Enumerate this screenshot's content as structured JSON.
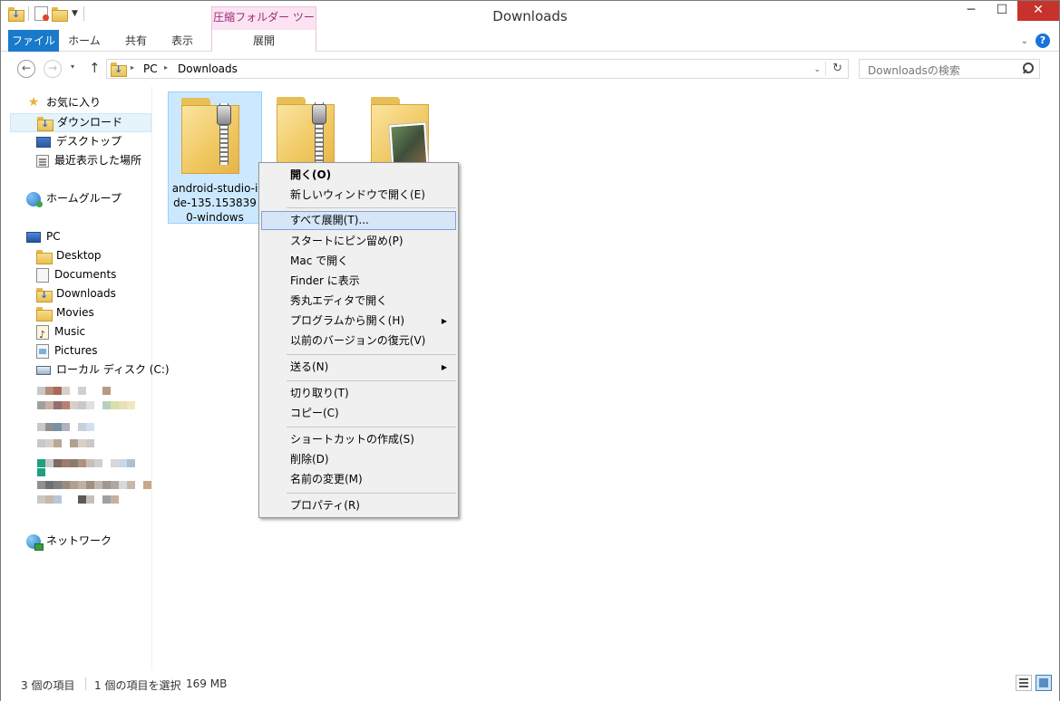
{
  "window": {
    "title": "Downloads"
  },
  "ribbon": {
    "context_group_label": "圧縮フォルダー ツール",
    "tabs": {
      "file": "ファイル",
      "home": "ホーム",
      "share": "共有",
      "view": "表示",
      "extract": "展開"
    },
    "help_label": "?"
  },
  "caption": {
    "minimize": "─",
    "maximize": "☐",
    "close": "✕"
  },
  "address": {
    "back": "←",
    "forward": "→",
    "dropdown": "▾",
    "up": "↑",
    "crumbs": [
      "PC",
      "Downloads"
    ],
    "refresh": "↻",
    "separator": "▸"
  },
  "search": {
    "placeholder": "Downloadsの検索"
  },
  "nav": {
    "favorites": "お気に入り",
    "downloads_jp": "ダウンロード",
    "desktop_jp": "デスクトップ",
    "recent": "最近表示した場所",
    "homegroup": "ホームグループ",
    "pc": "PC",
    "desktop": "Desktop",
    "documents": "Documents",
    "downloads": "Downloads",
    "movies": "Movies",
    "music": "Music",
    "pictures": "Pictures",
    "local_disk": "ローカル ディスク (C:)",
    "network": "ネットワーク"
  },
  "items": [
    {
      "name": "android-studio-ide-135.1538390-windows",
      "selected": true,
      "icon": "zip-folder-icon"
    },
    {
      "name": "",
      "selected": false,
      "icon": "zip-folder-icon"
    },
    {
      "name": "",
      "selected": false,
      "icon": "photo-folder-icon"
    }
  ],
  "context_menu": {
    "open": "開く(O)",
    "open_new_window": "新しいウィンドウで開く(E)",
    "extract_all": "すべて展開(T)...",
    "pin_start": "スタートにピン留め(P)",
    "open_mac": "Mac で開く",
    "show_finder": "Finder に表示",
    "open_hidemaru": "秀丸エディタで開く",
    "open_with": "プログラムから開く(H)",
    "restore_versions": "以前のバージョンの復元(V)",
    "send_to": "送る(N)",
    "cut": "切り取り(T)",
    "copy": "コピー(C)",
    "create_shortcut": "ショートカットの作成(S)",
    "delete": "削除(D)",
    "rename": "名前の変更(M)",
    "properties": "プロパティ(R)"
  },
  "status": {
    "item_count": "3 個の項目",
    "selection": "1 個の項目を選択",
    "size": "169 MB"
  },
  "colors": {
    "accent": "#1979ca",
    "selection": "#cce8ff",
    "context_tab": "#fbe3f2",
    "close_button": "#c7322d"
  }
}
